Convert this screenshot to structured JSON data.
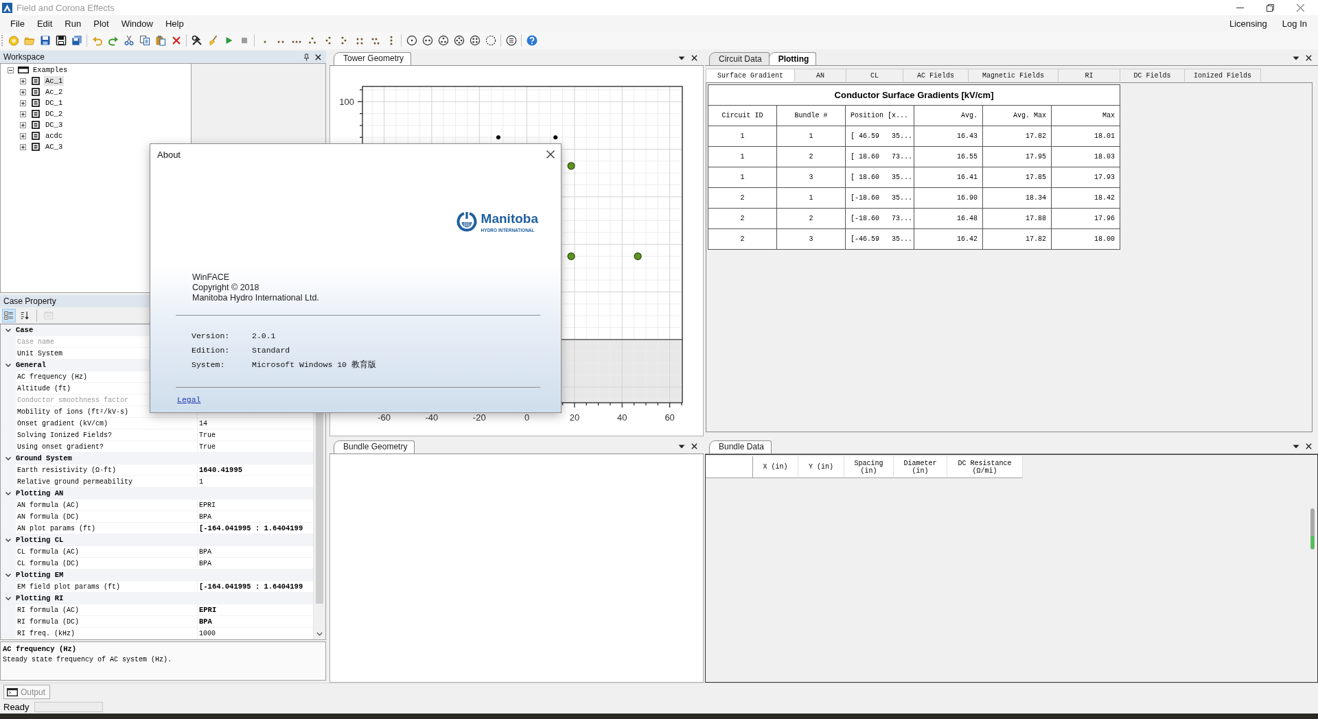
{
  "window": {
    "title": "Field and Corona Effects"
  },
  "menu": {
    "items": [
      "File",
      "Edit",
      "Run",
      "Plot",
      "Window",
      "Help"
    ],
    "account_links": [
      "Licensing",
      "Log In"
    ]
  },
  "workspace": {
    "title": "Workspace",
    "tree": [
      {
        "label": "Examples",
        "expanded": true,
        "selected": false,
        "children": [
          {
            "label": "Ac_1",
            "expanded": false,
            "selected": true
          },
          {
            "label": "Ac_2",
            "expanded": false,
            "selected": false
          },
          {
            "label": "DC_1",
            "expanded": false,
            "selected": false
          },
          {
            "label": "DC_2",
            "expanded": false,
            "selected": false
          },
          {
            "label": "DC_3",
            "expanded": false,
            "selected": false
          },
          {
            "label": "acdc",
            "expanded": false,
            "selected": false
          },
          {
            "label": "AC_3",
            "expanded": false,
            "selected": false
          }
        ]
      }
    ]
  },
  "case_property": {
    "title": "Case Property",
    "view_buttons": [
      {
        "kind": "categorized",
        "selected": true,
        "disabled": false
      },
      {
        "kind": "alphabetical",
        "selected": false,
        "disabled": false
      },
      {
        "kind": "property_pages",
        "selected": false,
        "disabled": true
      }
    ],
    "groups": [
      {
        "label": "Case",
        "expanded": true,
        "properties": [
          {
            "name": "Case name",
            "disabled": true
          },
          {
            "name": "Unit System",
            "disabled": false
          }
        ]
      },
      {
        "label": "General",
        "expanded": true,
        "properties": [
          {
            "name": "AC frequency (Hz)",
            "disabled": false
          },
          {
            "name": "Altitude (ft)",
            "disabled": false
          },
          {
            "name": "Conductor smoothness factor",
            "disabled": true
          },
          {
            "name": "Mobility of ions (ft²/kV·s)",
            "disabled": false
          },
          {
            "name": "Onset gradient (kV/cm)",
            "value": "14",
            "modified": false,
            "disabled": false
          },
          {
            "name": "Solving Ionized Fields?",
            "value": "True",
            "modified": false,
            "disabled": false
          },
          {
            "name": "Using onset gradient?",
            "value": "True",
            "modified": false,
            "disabled": false
          }
        ]
      },
      {
        "label": "Ground System",
        "expanded": true,
        "properties": [
          {
            "name": "Earth resistivity (Ω·ft)",
            "value": "1640.41995",
            "modified": true,
            "disabled": false
          },
          {
            "name": "Relative ground permeability",
            "value": "1",
            "modified": false,
            "disabled": false
          }
        ]
      },
      {
        "label": "Plotting AN",
        "expanded": true,
        "properties": [
          {
            "name": "AN formula (AC)",
            "value": "EPRI",
            "modified": false,
            "disabled": false
          },
          {
            "name": "AN formula (DC)",
            "value": "BPA",
            "modified": false,
            "disabled": false
          },
          {
            "name": "AN plot params (ft)",
            "value": "[-164.041995 : 1.6404199",
            "modified": true,
            "disabled": false
          }
        ]
      },
      {
        "label": "Plotting CL",
        "expanded": true,
        "properties": [
          {
            "name": "CL formula (AC)",
            "value": "BPA",
            "modified": false,
            "disabled": false
          },
          {
            "name": "CL formula (DC)",
            "value": "BPA",
            "modified": false,
            "disabled": false
          }
        ]
      },
      {
        "label": "Plotting EM",
        "expanded": true,
        "properties": [
          {
            "name": "EM field plot params (ft)",
            "value": "[-164.041995 : 1.6404199",
            "modified": true,
            "disabled": false
          }
        ]
      },
      {
        "label": "Plotting RI",
        "expanded": true,
        "properties": [
          {
            "name": "RI formula (AC)",
            "value": "EPRI",
            "modified": true,
            "disabled": false
          },
          {
            "name": "RI formula (DC)",
            "value": "BPA",
            "modified": true,
            "disabled": false
          },
          {
            "name": "RI freq. (kHz)",
            "value": "1000",
            "modified": false,
            "disabled": false
          }
        ]
      }
    ],
    "description": {
      "title": "AC frequency (Hz)",
      "text": "Steady state frequency of AC system (Hz)."
    }
  },
  "tower_geometry": {
    "tab": "Tower Geometry",
    "x_axis_labels": [
      "-60",
      "-40",
      "-20",
      "0",
      "20",
      "40",
      "60"
    ],
    "y_axis_labels": [
      "100"
    ]
  },
  "bundle_geometry": {
    "tab": "Bundle Geometry"
  },
  "plotting": {
    "tabs": [
      {
        "label": "Circuit Data",
        "selected": false
      },
      {
        "label": "Plotting",
        "selected": true
      }
    ],
    "subtabs": [
      {
        "label": "Surface Gradient",
        "selected": true
      },
      {
        "label": "AN",
        "selected": false
      },
      {
        "label": "CL",
        "selected": false
      },
      {
        "label": "AC Fields",
        "selected": false
      },
      {
        "label": "Magnetic Fields",
        "selected": false
      },
      {
        "label": "RI",
        "selected": false
      },
      {
        "label": "DC Fields",
        "selected": false
      },
      {
        "label": "Ionized Fields",
        "selected": false
      }
    ],
    "table": {
      "title": "Conductor Surface Gradients [kV/cm]",
      "columns": [
        "Circuit ID",
        "Bundle #",
        "Position [x...",
        "Avg.",
        "Avg. Max",
        "Max"
      ],
      "rows": [
        [
          "1",
          "1",
          "[ 46.59   35...",
          "16.43",
          "17.82",
          "18.01"
        ],
        [
          "1",
          "2",
          "[ 18.60   73...",
          "16.55",
          "17.95",
          "18.03"
        ],
        [
          "1",
          "3",
          "[ 18.60   35...",
          "16.41",
          "17.85",
          "17.93"
        ],
        [
          "2",
          "1",
          "[-18.60   35...",
          "16.90",
          "18.34",
          "18.42"
        ],
        [
          "2",
          "2",
          "[-18.60   73...",
          "16.48",
          "17.88",
          "17.96"
        ],
        [
          "2",
          "3",
          "[-46.59   35...",
          "16.42",
          "17.82",
          "18.00"
        ]
      ]
    }
  },
  "bundle_data": {
    "tab": "Bundle Data",
    "columns": [
      "X (in)",
      "Y (in)",
      "Spacing (in)",
      "Diameter (in)",
      "DC Resistance (Ω/mi)"
    ]
  },
  "output_tab": {
    "label": "Output"
  },
  "status_bar": {
    "text": "Ready"
  },
  "about_dialog": {
    "title": "About",
    "logo": {
      "name": "Manitoba",
      "tagline": "HYDRO INTERNATIONAL"
    },
    "product": "WinFACE",
    "copyright": "Copyright © 2018",
    "company": "Manitoba Hydro International Ltd.",
    "info": [
      {
        "label": "Version:",
        "value": "2.0.1"
      },
      {
        "label": "Edition:",
        "value": "Standard"
      },
      {
        "label": "System:",
        "value": "Microsoft Windows 10 教育版"
      }
    ],
    "link": "Legal"
  }
}
